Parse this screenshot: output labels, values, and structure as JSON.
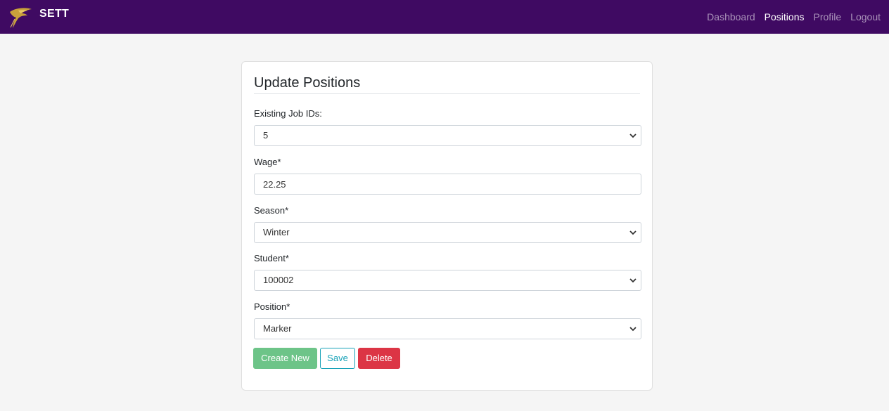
{
  "navbar": {
    "brand": "SETT",
    "links": [
      "Dashboard",
      "Positions",
      "Profile",
      "Logout"
    ],
    "active": "Positions",
    "bg_color": "#3f0a62"
  },
  "form": {
    "title": "Update Positions",
    "job_ids": {
      "label": "Existing Job IDs:",
      "value": "5"
    },
    "wage": {
      "label": "Wage*",
      "value": "22.25"
    },
    "season": {
      "label": "Season*",
      "value": "Winter"
    },
    "student": {
      "label": "Student*",
      "value": "100002"
    },
    "position": {
      "label": "Position*",
      "value": "Marker"
    }
  },
  "buttons": {
    "create": "Create New",
    "save": "Save",
    "delete": "Delete"
  },
  "colors": {
    "create": "#6dc488",
    "save": "#17a2b8",
    "delete": "#dc3545"
  }
}
